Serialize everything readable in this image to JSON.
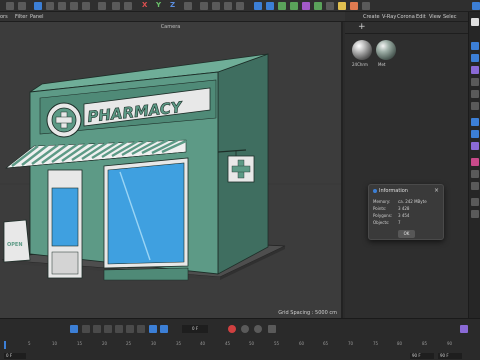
{
  "toolbar": {
    "menu_partial": "ors",
    "filter_label": "Filter",
    "panel_label": "Panel",
    "axis_x": "X",
    "axis_y": "Y",
    "axis_z": "Z"
  },
  "viewport": {
    "title": "Camera",
    "grid_spacing": "Grid Spacing : 5000 cm",
    "scene_sign_text": "PHARMACY",
    "small_sign_text": "OPEN"
  },
  "right_panel": {
    "menu": [
      "Create",
      "V-Ray",
      "Corona",
      "Edit",
      "View",
      "Selec"
    ],
    "materials": [
      {
        "label": "24Chrm"
      },
      {
        "label": "Met"
      }
    ]
  },
  "info_dialog": {
    "title": "Information",
    "rows": [
      {
        "label": "Memory:",
        "value": "ca. 242 MByte"
      },
      {
        "label": "Points:",
        "value": "3 428"
      },
      {
        "label": "Polygons:",
        "value": "3 454"
      },
      {
        "label": "Objects:",
        "value": "7"
      }
    ],
    "ok_label": "OK"
  },
  "timeline": {
    "frame_field": "0 F",
    "ticks": [
      "0",
      "5",
      "10",
      "15",
      "20",
      "25",
      "30",
      "35",
      "40",
      "45",
      "50",
      "55",
      "60",
      "65",
      "70",
      "75",
      "80",
      "85",
      "90"
    ],
    "start_field": "0 F",
    "end_field_1": "90 F",
    "end_field_2": "90 F"
  },
  "colors": {
    "accent_blue": "#3c7fd6",
    "building_green": "#5d9a86",
    "building_dark": "#3f6e60",
    "glass": "#3fa0e0"
  }
}
